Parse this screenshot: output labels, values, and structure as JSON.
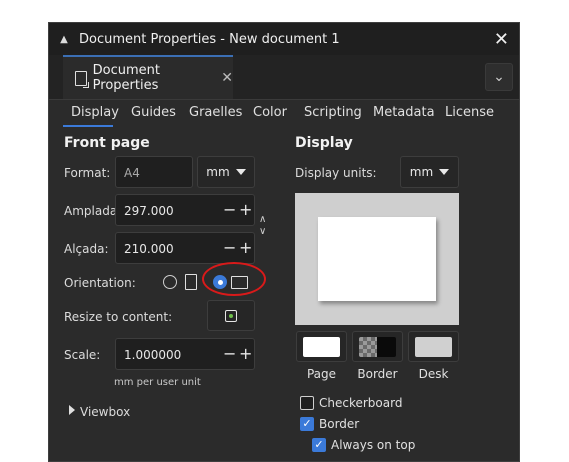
{
  "window": {
    "title": "Document Properties - New document 1",
    "close_glyph": "✕"
  },
  "dock": {
    "tab_label": "Document Properties",
    "tab_close": "✕",
    "menu_glyph": "⌄"
  },
  "tabs": [
    {
      "label": "Display",
      "active": true
    },
    {
      "label": "Guides"
    },
    {
      "label": "Graelles"
    },
    {
      "label": "Color"
    },
    {
      "label": "Scripting"
    },
    {
      "label": "Metadata"
    },
    {
      "label": "License"
    }
  ],
  "front_page": {
    "title": "Front page",
    "format_label": "Format:",
    "format_value": "A4",
    "format_unit": "mm",
    "width_label": "Amplada:",
    "width_value": "297.000",
    "height_label": "Alçada:",
    "height_value": "210.000",
    "orientation_label": "Orientation:",
    "orientation": "landscape",
    "resize_label": "Resize to content:",
    "scale_label": "Scale:",
    "scale_value": "1.000000",
    "scale_unit_text": "mm  per user unit",
    "viewbox_label": "Viewbox",
    "minus_glyph": "−",
    "plus_glyph": "+"
  },
  "display": {
    "title": "Display",
    "units_label": "Display units:",
    "units_value": "mm",
    "swatches": [
      {
        "label": "Page"
      },
      {
        "label": "Border"
      },
      {
        "label": "Desk"
      }
    ],
    "checkerboard_label": "Checkerboard",
    "checkerboard_checked": false,
    "border_label": "Border",
    "border_checked": true,
    "always_on_top_label": "Always on top",
    "always_on_top_checked": true,
    "check_glyph": "✓"
  },
  "colors": {
    "accent": "#3b7ad9",
    "annotation": "#d91a1a"
  }
}
